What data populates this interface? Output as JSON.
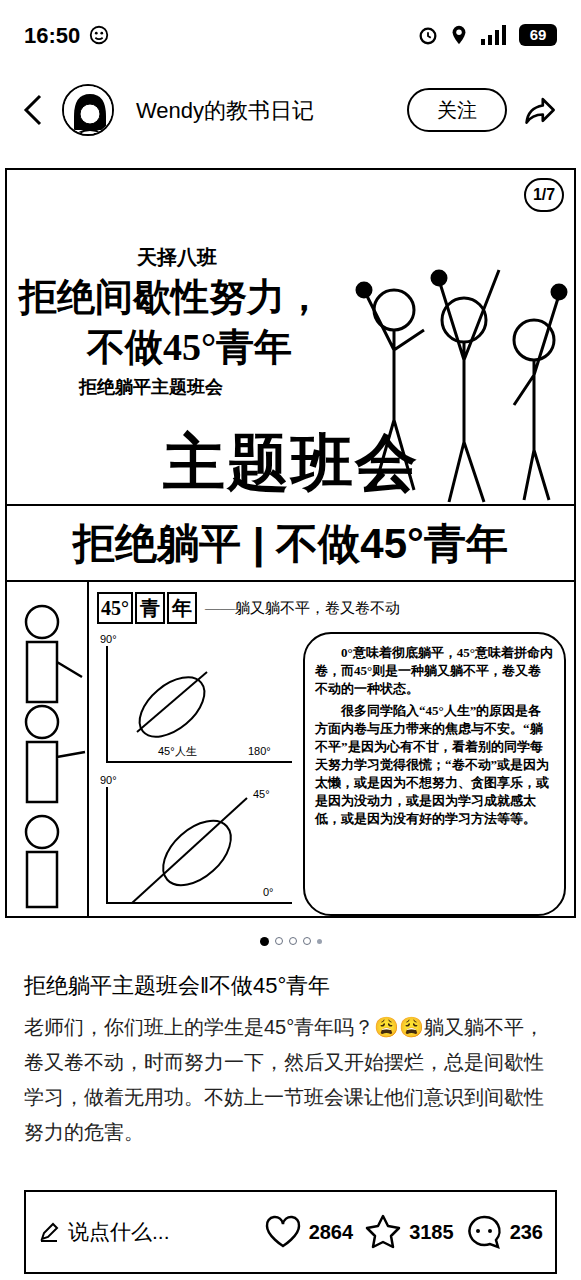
{
  "status_bar": {
    "time": "16:50",
    "battery": "69"
  },
  "header": {
    "author": "Wendy的教书日记",
    "follow": "关注"
  },
  "post_image": {
    "counter": "1/7",
    "class_name": "天择八班",
    "headline_1": "拒绝间歇性努力，",
    "headline_2": "不做45°青年",
    "subtitle": "拒绝躺平主题班会",
    "big_title": "主题班会",
    "banner": "拒绝躺平 | 不做45°青年",
    "term_chars": [
      "45°",
      "青",
      "年"
    ],
    "term_desc": "——躺又躺不平，卷又卷不动",
    "charts": [
      {
        "labels": [
          "90°",
          "45°人生",
          "180°"
        ]
      },
      {
        "labels": [
          "90°",
          "45°",
          "0°"
        ]
      }
    ],
    "paragraphs": [
      "0°意味着彻底躺平，45°意味着拼命内卷，而45°则是一种躺又躺不平，卷又卷不动的一种状态。",
      "很多同学陷入“45°人生”的原因是各方面内卷与压力带来的焦虑与不安。“躺不平”是因为心有不甘，看着别的同学每天努力学习觉得很慌；“卷不动”或是因为太懒，或是因为不想努力、贪图享乐，或是因为没动力，或是因为学习成就感太低，或是因为没有好的学习方法等等。"
    ]
  },
  "carousel_dots": [
    {
      "selected": true
    },
    {
      "selected": false
    },
    {
      "selected": false
    },
    {
      "selected": false
    },
    {
      "selected": false
    }
  ],
  "post": {
    "title": "拒绝躺平主题班会‖不做45°青年",
    "body": "老师们，你们班上的学生是45°青年吗？😩😩躺又躺不平，卷又卷不动，时而努力一下，然后又开始摆烂，总是间歇性学习，做着无用功。不妨上一节班会课让他们意识到间歇性努力的危害。"
  },
  "bottom_bar": {
    "comment_placeholder": "说点什么...",
    "likes": "2864",
    "favorites": "3185",
    "comments": "236"
  }
}
